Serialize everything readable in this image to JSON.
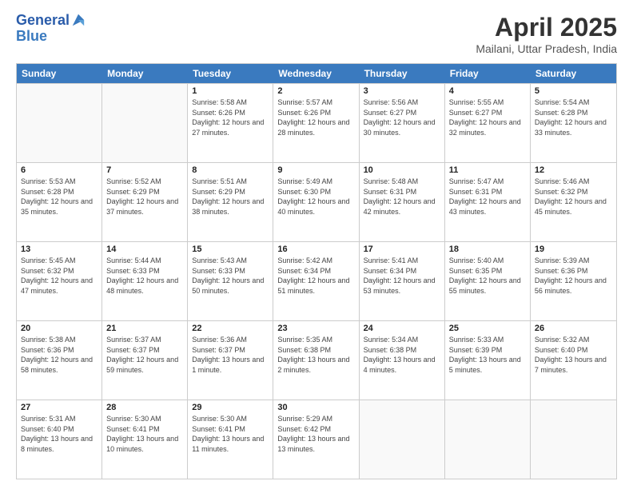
{
  "logo": {
    "line1": "General",
    "line2": "Blue"
  },
  "title": "April 2025",
  "location": "Mailani, Uttar Pradesh, India",
  "header_days": [
    "Sunday",
    "Monday",
    "Tuesday",
    "Wednesday",
    "Thursday",
    "Friday",
    "Saturday"
  ],
  "weeks": [
    [
      {
        "day": "",
        "sunrise": "",
        "sunset": "",
        "daylight": ""
      },
      {
        "day": "",
        "sunrise": "",
        "sunset": "",
        "daylight": ""
      },
      {
        "day": "1",
        "sunrise": "Sunrise: 5:58 AM",
        "sunset": "Sunset: 6:26 PM",
        "daylight": "Daylight: 12 hours and 27 minutes."
      },
      {
        "day": "2",
        "sunrise": "Sunrise: 5:57 AM",
        "sunset": "Sunset: 6:26 PM",
        "daylight": "Daylight: 12 hours and 28 minutes."
      },
      {
        "day": "3",
        "sunrise": "Sunrise: 5:56 AM",
        "sunset": "Sunset: 6:27 PM",
        "daylight": "Daylight: 12 hours and 30 minutes."
      },
      {
        "day": "4",
        "sunrise": "Sunrise: 5:55 AM",
        "sunset": "Sunset: 6:27 PM",
        "daylight": "Daylight: 12 hours and 32 minutes."
      },
      {
        "day": "5",
        "sunrise": "Sunrise: 5:54 AM",
        "sunset": "Sunset: 6:28 PM",
        "daylight": "Daylight: 12 hours and 33 minutes."
      }
    ],
    [
      {
        "day": "6",
        "sunrise": "Sunrise: 5:53 AM",
        "sunset": "Sunset: 6:28 PM",
        "daylight": "Daylight: 12 hours and 35 minutes."
      },
      {
        "day": "7",
        "sunrise": "Sunrise: 5:52 AM",
        "sunset": "Sunset: 6:29 PM",
        "daylight": "Daylight: 12 hours and 37 minutes."
      },
      {
        "day": "8",
        "sunrise": "Sunrise: 5:51 AM",
        "sunset": "Sunset: 6:29 PM",
        "daylight": "Daylight: 12 hours and 38 minutes."
      },
      {
        "day": "9",
        "sunrise": "Sunrise: 5:49 AM",
        "sunset": "Sunset: 6:30 PM",
        "daylight": "Daylight: 12 hours and 40 minutes."
      },
      {
        "day": "10",
        "sunrise": "Sunrise: 5:48 AM",
        "sunset": "Sunset: 6:31 PM",
        "daylight": "Daylight: 12 hours and 42 minutes."
      },
      {
        "day": "11",
        "sunrise": "Sunrise: 5:47 AM",
        "sunset": "Sunset: 6:31 PM",
        "daylight": "Daylight: 12 hours and 43 minutes."
      },
      {
        "day": "12",
        "sunrise": "Sunrise: 5:46 AM",
        "sunset": "Sunset: 6:32 PM",
        "daylight": "Daylight: 12 hours and 45 minutes."
      }
    ],
    [
      {
        "day": "13",
        "sunrise": "Sunrise: 5:45 AM",
        "sunset": "Sunset: 6:32 PM",
        "daylight": "Daylight: 12 hours and 47 minutes."
      },
      {
        "day": "14",
        "sunrise": "Sunrise: 5:44 AM",
        "sunset": "Sunset: 6:33 PM",
        "daylight": "Daylight: 12 hours and 48 minutes."
      },
      {
        "day": "15",
        "sunrise": "Sunrise: 5:43 AM",
        "sunset": "Sunset: 6:33 PM",
        "daylight": "Daylight: 12 hours and 50 minutes."
      },
      {
        "day": "16",
        "sunrise": "Sunrise: 5:42 AM",
        "sunset": "Sunset: 6:34 PM",
        "daylight": "Daylight: 12 hours and 51 minutes."
      },
      {
        "day": "17",
        "sunrise": "Sunrise: 5:41 AM",
        "sunset": "Sunset: 6:34 PM",
        "daylight": "Daylight: 12 hours and 53 minutes."
      },
      {
        "day": "18",
        "sunrise": "Sunrise: 5:40 AM",
        "sunset": "Sunset: 6:35 PM",
        "daylight": "Daylight: 12 hours and 55 minutes."
      },
      {
        "day": "19",
        "sunrise": "Sunrise: 5:39 AM",
        "sunset": "Sunset: 6:36 PM",
        "daylight": "Daylight: 12 hours and 56 minutes."
      }
    ],
    [
      {
        "day": "20",
        "sunrise": "Sunrise: 5:38 AM",
        "sunset": "Sunset: 6:36 PM",
        "daylight": "Daylight: 12 hours and 58 minutes."
      },
      {
        "day": "21",
        "sunrise": "Sunrise: 5:37 AM",
        "sunset": "Sunset: 6:37 PM",
        "daylight": "Daylight: 12 hours and 59 minutes."
      },
      {
        "day": "22",
        "sunrise": "Sunrise: 5:36 AM",
        "sunset": "Sunset: 6:37 PM",
        "daylight": "Daylight: 13 hours and 1 minute."
      },
      {
        "day": "23",
        "sunrise": "Sunrise: 5:35 AM",
        "sunset": "Sunset: 6:38 PM",
        "daylight": "Daylight: 13 hours and 2 minutes."
      },
      {
        "day": "24",
        "sunrise": "Sunrise: 5:34 AM",
        "sunset": "Sunset: 6:38 PM",
        "daylight": "Daylight: 13 hours and 4 minutes."
      },
      {
        "day": "25",
        "sunrise": "Sunrise: 5:33 AM",
        "sunset": "Sunset: 6:39 PM",
        "daylight": "Daylight: 13 hours and 5 minutes."
      },
      {
        "day": "26",
        "sunrise": "Sunrise: 5:32 AM",
        "sunset": "Sunset: 6:40 PM",
        "daylight": "Daylight: 13 hours and 7 minutes."
      }
    ],
    [
      {
        "day": "27",
        "sunrise": "Sunrise: 5:31 AM",
        "sunset": "Sunset: 6:40 PM",
        "daylight": "Daylight: 13 hours and 8 minutes."
      },
      {
        "day": "28",
        "sunrise": "Sunrise: 5:30 AM",
        "sunset": "Sunset: 6:41 PM",
        "daylight": "Daylight: 13 hours and 10 minutes."
      },
      {
        "day": "29",
        "sunrise": "Sunrise: 5:30 AM",
        "sunset": "Sunset: 6:41 PM",
        "daylight": "Daylight: 13 hours and 11 minutes."
      },
      {
        "day": "30",
        "sunrise": "Sunrise: 5:29 AM",
        "sunset": "Sunset: 6:42 PM",
        "daylight": "Daylight: 13 hours and 13 minutes."
      },
      {
        "day": "",
        "sunrise": "",
        "sunset": "",
        "daylight": ""
      },
      {
        "day": "",
        "sunrise": "",
        "sunset": "",
        "daylight": ""
      },
      {
        "day": "",
        "sunrise": "",
        "sunset": "",
        "daylight": ""
      }
    ]
  ]
}
